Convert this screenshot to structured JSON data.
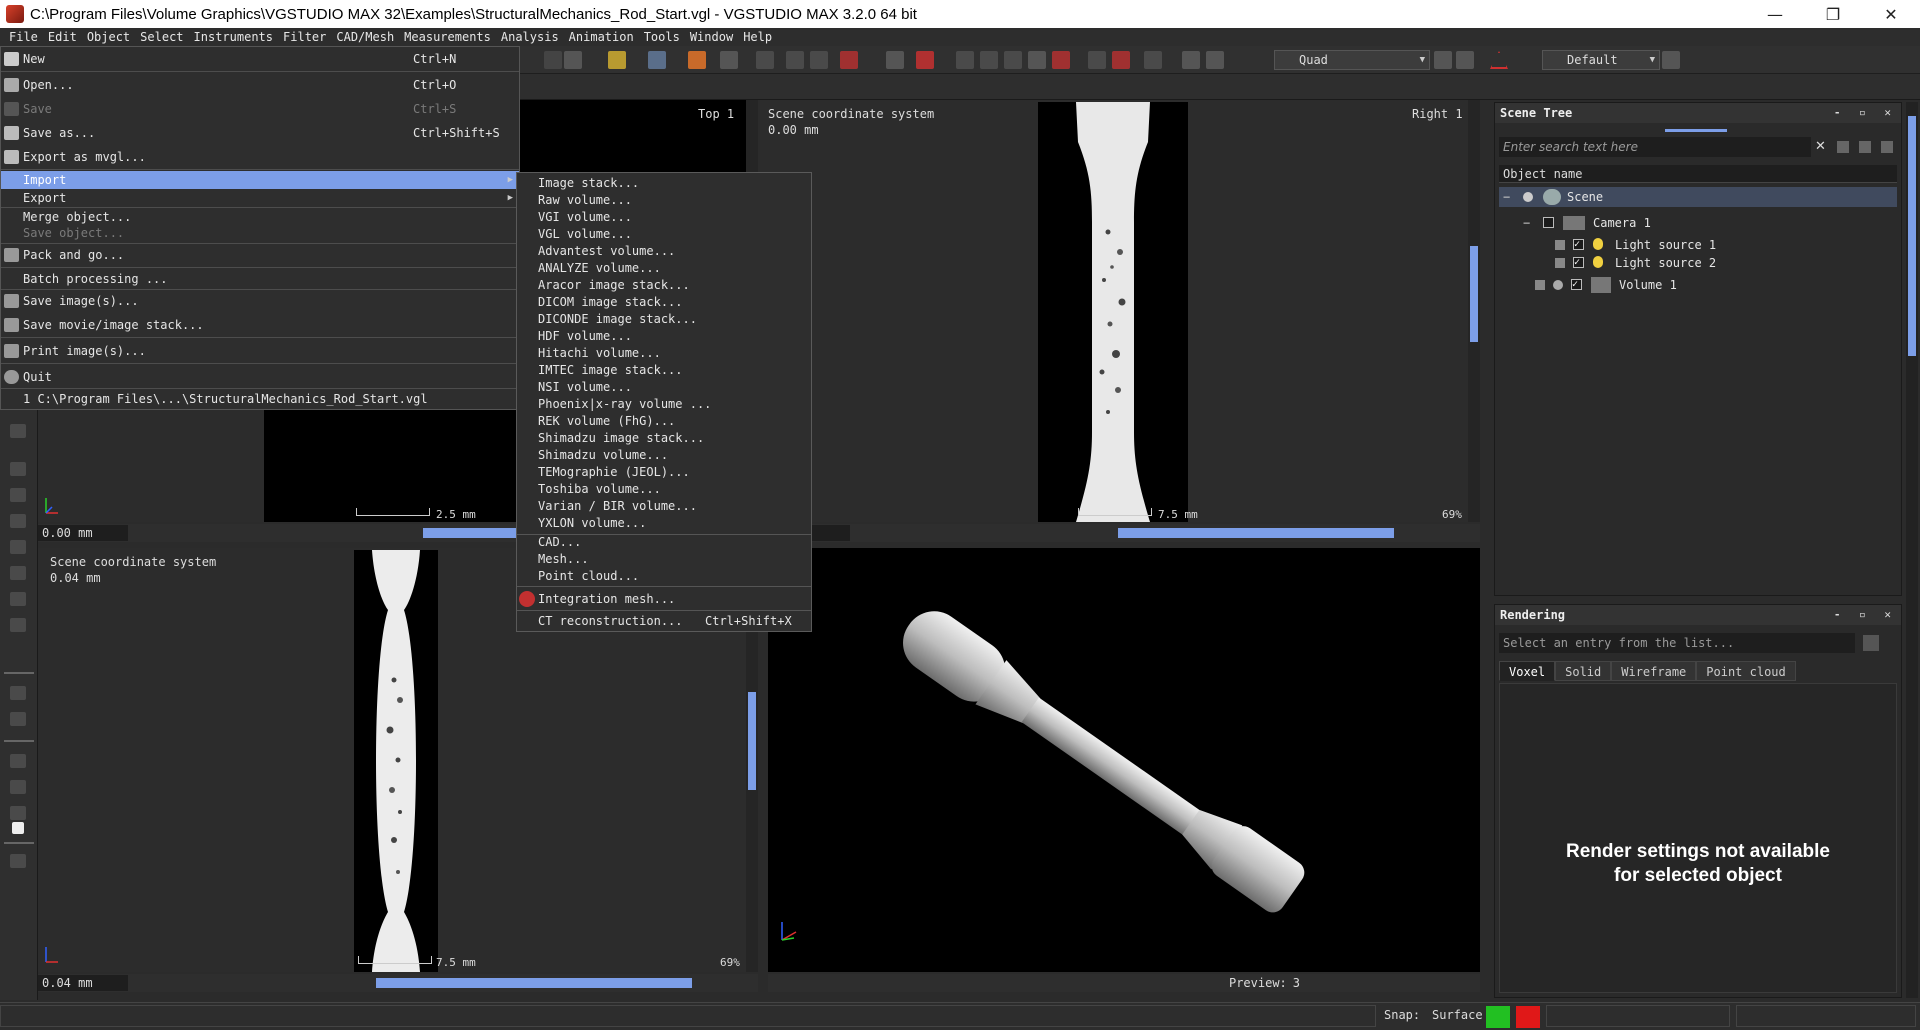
{
  "window": {
    "title": "C:\\Program Files\\Volume Graphics\\VGSTUDIO MAX 32\\Examples\\StructuralMechanics_Rod_Start.vgl  - VGSTUDIO MAX 3.2.0 64 bit",
    "minimize": "—",
    "maximize": "❐",
    "close": "✕"
  },
  "menubar": [
    "File",
    "Edit",
    "Object",
    "Select",
    "Instruments",
    "Filter",
    "CAD/Mesh",
    "Measurements",
    "Analysis",
    "Animation",
    "Tools",
    "Window",
    "Help"
  ],
  "toolbar": {
    "layout_combo": "Quad",
    "workspace_combo": "Default"
  },
  "file_menu": {
    "items": [
      {
        "label": "New",
        "shortcut": "Ctrl+N",
        "icon": "new-file-icon",
        "disabled": false
      },
      {
        "label": "Open...",
        "shortcut": "Ctrl+O",
        "icon": "open-folder-icon",
        "disabled": false
      },
      {
        "label": "Save",
        "shortcut": "Ctrl+S",
        "icon": "save-icon",
        "disabled": true
      },
      {
        "label": "Save as...",
        "shortcut": "Ctrl+Shift+S",
        "icon": "save-as-icon",
        "disabled": false
      },
      {
        "label": "Export as mvgl...",
        "shortcut": "",
        "icon": "export-mvgl-icon",
        "disabled": false
      },
      {
        "label": "Import",
        "shortcut": "",
        "icon": "",
        "disabled": false,
        "submenu": true,
        "highlight": true
      },
      {
        "label": "Export",
        "shortcut": "",
        "icon": "",
        "disabled": false,
        "submenu": true
      },
      {
        "label": "Merge object...",
        "shortcut": "",
        "icon": "",
        "disabled": false
      },
      {
        "label": "Save object...",
        "shortcut": "",
        "icon": "",
        "disabled": true
      },
      {
        "label": "Pack and go...",
        "shortcut": "",
        "icon": "pack-icon",
        "disabled": false
      },
      {
        "label": "Batch processing ...",
        "shortcut": "",
        "icon": "",
        "disabled": false
      },
      {
        "label": "Save image(s)...",
        "shortcut": "",
        "icon": "camera-icon",
        "disabled": false
      },
      {
        "label": "Save movie/image stack...",
        "shortcut": "",
        "icon": "film-icon",
        "disabled": false
      },
      {
        "label": "Print image(s)...",
        "shortcut": "",
        "icon": "printer-icon",
        "disabled": false
      },
      {
        "label": "Quit",
        "shortcut": "",
        "icon": "power-icon",
        "disabled": false
      },
      {
        "label": "1 C:\\Program Files\\...\\StructuralMechanics_Rod_Start.vgl",
        "shortcut": "",
        "icon": "",
        "disabled": false
      }
    ]
  },
  "import_menu": {
    "items": [
      "Image stack...",
      "Raw volume...",
      "VGI volume...",
      "VGL volume...",
      "Advantest volume...",
      "ANALYZE volume...",
      "Aracor image stack...",
      "DICOM image stack...",
      "DICONDE image stack...",
      "HDF volume...",
      "Hitachi volume...",
      "IMTEC image stack...",
      "NSI volume...",
      "Phoenix|x-ray volume ...",
      "REK volume (FhG)...",
      "Shimadzu image stack...",
      "Shimadzu volume...",
      "TEMographie (JEOL)...",
      "Toshiba volume...",
      "Varian / BIR volume...",
      "YXLON volume...",
      "CAD...",
      "Mesh...",
      "Point cloud...",
      "Integration mesh...",
      "CT reconstruction..."
    ],
    "ct_shortcut": "Ctrl+Shift+X"
  },
  "viewports": {
    "top": {
      "label": "Top",
      "index": "1",
      "coord": "0.00 mm",
      "scale": "2.5 mm"
    },
    "right": {
      "label": "Right",
      "index": "1",
      "system": "Scene coordinate system",
      "coord_text": "0.00  mm",
      "coord": "",
      "scale": "7.5 mm",
      "zoom": "69%"
    },
    "front": {
      "system": "Scene coordinate system",
      "coord_text": "0.04  mm",
      "coord": "0.04 mm",
      "scale": "7.5 mm",
      "zoom": "69%"
    },
    "threed": {
      "preview_label": "Preview:",
      "preview_value": "3"
    }
  },
  "scene_tree": {
    "title": "Scene Tree",
    "search_placeholder": "Enter search text here",
    "column": "Object name",
    "rows": [
      {
        "label": "Scene"
      },
      {
        "label": "Camera 1"
      },
      {
        "label": "Light source 1"
      },
      {
        "label": "Light source 2"
      },
      {
        "label": "Volume 1"
      }
    ]
  },
  "rendering": {
    "title": "Rendering",
    "select_placeholder": "Select an entry from the list...",
    "tabs": [
      "Voxel",
      "Solid",
      "Wireframe",
      "Point cloud"
    ],
    "message_line1": "Render settings not available",
    "message_line2": "for selected object"
  },
  "statusbar": {
    "snap_label": "Snap:",
    "snap_value": "Surface"
  },
  "colors": {
    "accent": "#7c9ee8",
    "snap_green": "#22c022",
    "snap_red": "#e01818"
  }
}
